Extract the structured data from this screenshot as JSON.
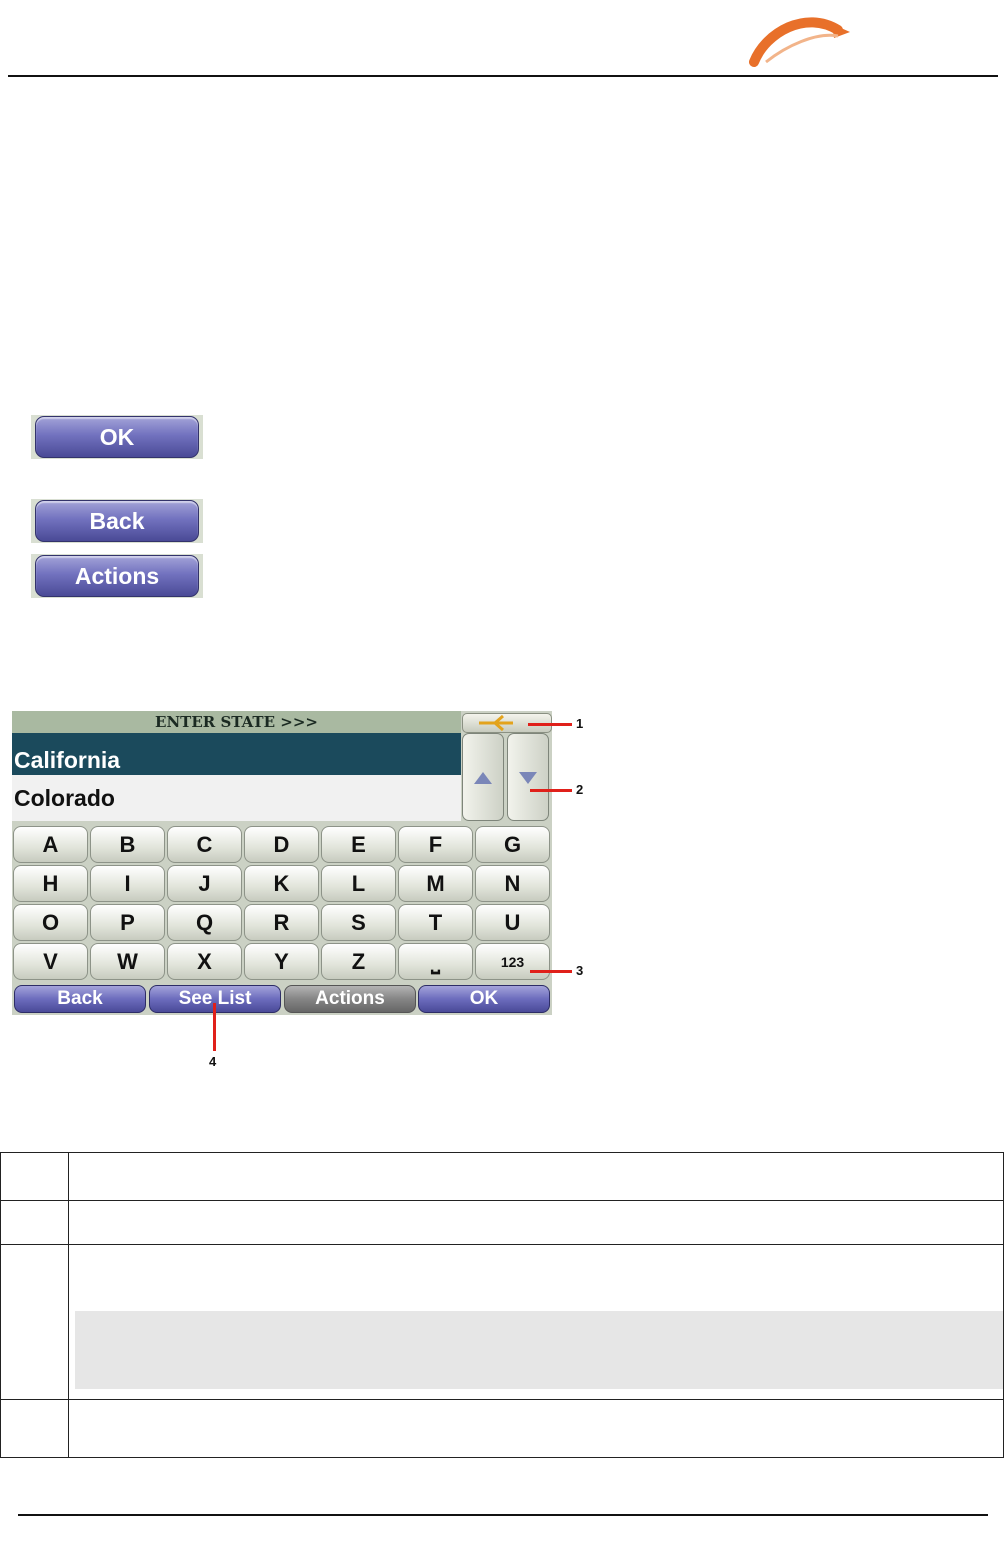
{
  "buttons": {
    "ok": "OK",
    "back": "Back",
    "actions": "Actions"
  },
  "screen": {
    "header": "ENTER STATE >>>",
    "list": [
      "California",
      "Colorado"
    ],
    "keys": [
      [
        "A",
        "B",
        "C",
        "D",
        "E",
        "F",
        "G"
      ],
      [
        "H",
        "I",
        "J",
        "K",
        "L",
        "M",
        "N"
      ],
      [
        "O",
        "P",
        "Q",
        "R",
        "S",
        "T",
        "U"
      ],
      [
        "V",
        "W",
        "X",
        "Y",
        "Z",
        "⎵",
        "123"
      ]
    ],
    "bottom": {
      "back": "Back",
      "see_list": "See List",
      "actions": "Actions",
      "ok": "OK"
    }
  },
  "callouts": [
    "1",
    "2",
    "3",
    "4"
  ],
  "colors": {
    "accent": "#e8702a",
    "selected_row": "#1b4a5c",
    "button_blue": "#6c6cbd"
  }
}
